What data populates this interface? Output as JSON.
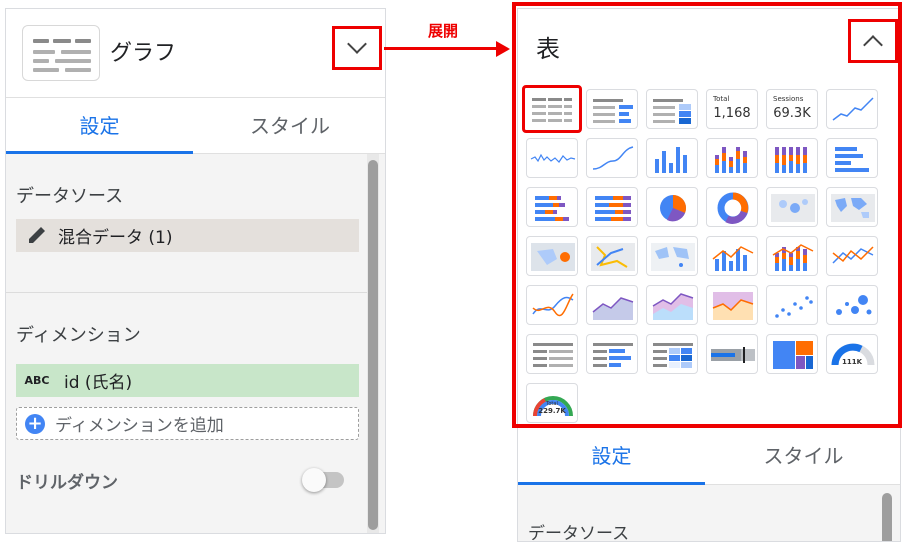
{
  "left_panel": {
    "title": "グラフ",
    "tabs": [
      {
        "label": "設定"
      },
      {
        "label": "スタイル"
      }
    ],
    "data_source_label": "データソース",
    "data_source_value": "混合データ (1)",
    "dimension_label": "ディメンション",
    "dimension_type_badge": "ABC",
    "dimension_value": "id (氏名)",
    "add_dimension_label": "ディメンションを追加",
    "drilldown_label": "ドリルダウン",
    "drilldown_enabled": false
  },
  "annotation": {
    "expand_label": "展開",
    "color": "#ee0000"
  },
  "right_panel": {
    "title": "表",
    "tabs": [
      {
        "label": "設定"
      },
      {
        "label": "スタイル"
      }
    ],
    "data_source_label": "データソース",
    "chart_types": [
      {
        "icon": "table-icon",
        "selected": true
      },
      {
        "icon": "table-bars-icon"
      },
      {
        "icon": "table-heatmap-icon"
      },
      {
        "icon": "scorecard-icon",
        "caption": "Total",
        "value": "1,168"
      },
      {
        "icon": "scorecard-compact-icon",
        "caption": "Sessions",
        "value": "69.3K"
      },
      {
        "icon": "time-series-icon"
      },
      {
        "icon": "sparkline-icon"
      },
      {
        "icon": "smoothed-line-icon"
      },
      {
        "icon": "column-chart-icon"
      },
      {
        "icon": "stacked-column-icon"
      },
      {
        "icon": "100-stacked-column-icon"
      },
      {
        "icon": "bar-chart-icon"
      },
      {
        "icon": "stacked-bar-icon"
      },
      {
        "icon": "100-stacked-bar-icon"
      },
      {
        "icon": "pie-chart-icon"
      },
      {
        "icon": "donut-chart-icon"
      },
      {
        "icon": "geo-map-icon"
      },
      {
        "icon": "geo-map-world-icon"
      },
      {
        "icon": "google-maps-icon"
      },
      {
        "icon": "route-map-icon"
      },
      {
        "icon": "bubble-map-icon"
      },
      {
        "icon": "combo-column-icon"
      },
      {
        "icon": "stacked-combo-icon"
      },
      {
        "icon": "line-chart-icon"
      },
      {
        "icon": "smoothed-combo-icon"
      },
      {
        "icon": "area-chart-icon"
      },
      {
        "icon": "stacked-area-icon"
      },
      {
        "icon": "100-stacked-area-icon"
      },
      {
        "icon": "scatter-chart-icon"
      },
      {
        "icon": "bubble-chart-icon"
      },
      {
        "icon": "pivot-table-icon"
      },
      {
        "icon": "pivot-table-bars-icon"
      },
      {
        "icon": "pivot-table-heatmap-icon"
      },
      {
        "icon": "bullet-chart-icon"
      },
      {
        "icon": "treemap-icon"
      },
      {
        "icon": "gauge-icon",
        "value": "111K"
      },
      {
        "icon": "gauge-colored-icon",
        "caption": "Total",
        "value": "229.7K"
      }
    ]
  },
  "colors": {
    "accent_blue": "#1a73e8",
    "chart_blue": "#4285f4",
    "chart_orange": "#ff6d01",
    "chart_purple": "#7e57c2",
    "highlight_red": "#ee0000",
    "dimension_green": "#c8e6c9",
    "source_chip": "#e4e0dc"
  }
}
